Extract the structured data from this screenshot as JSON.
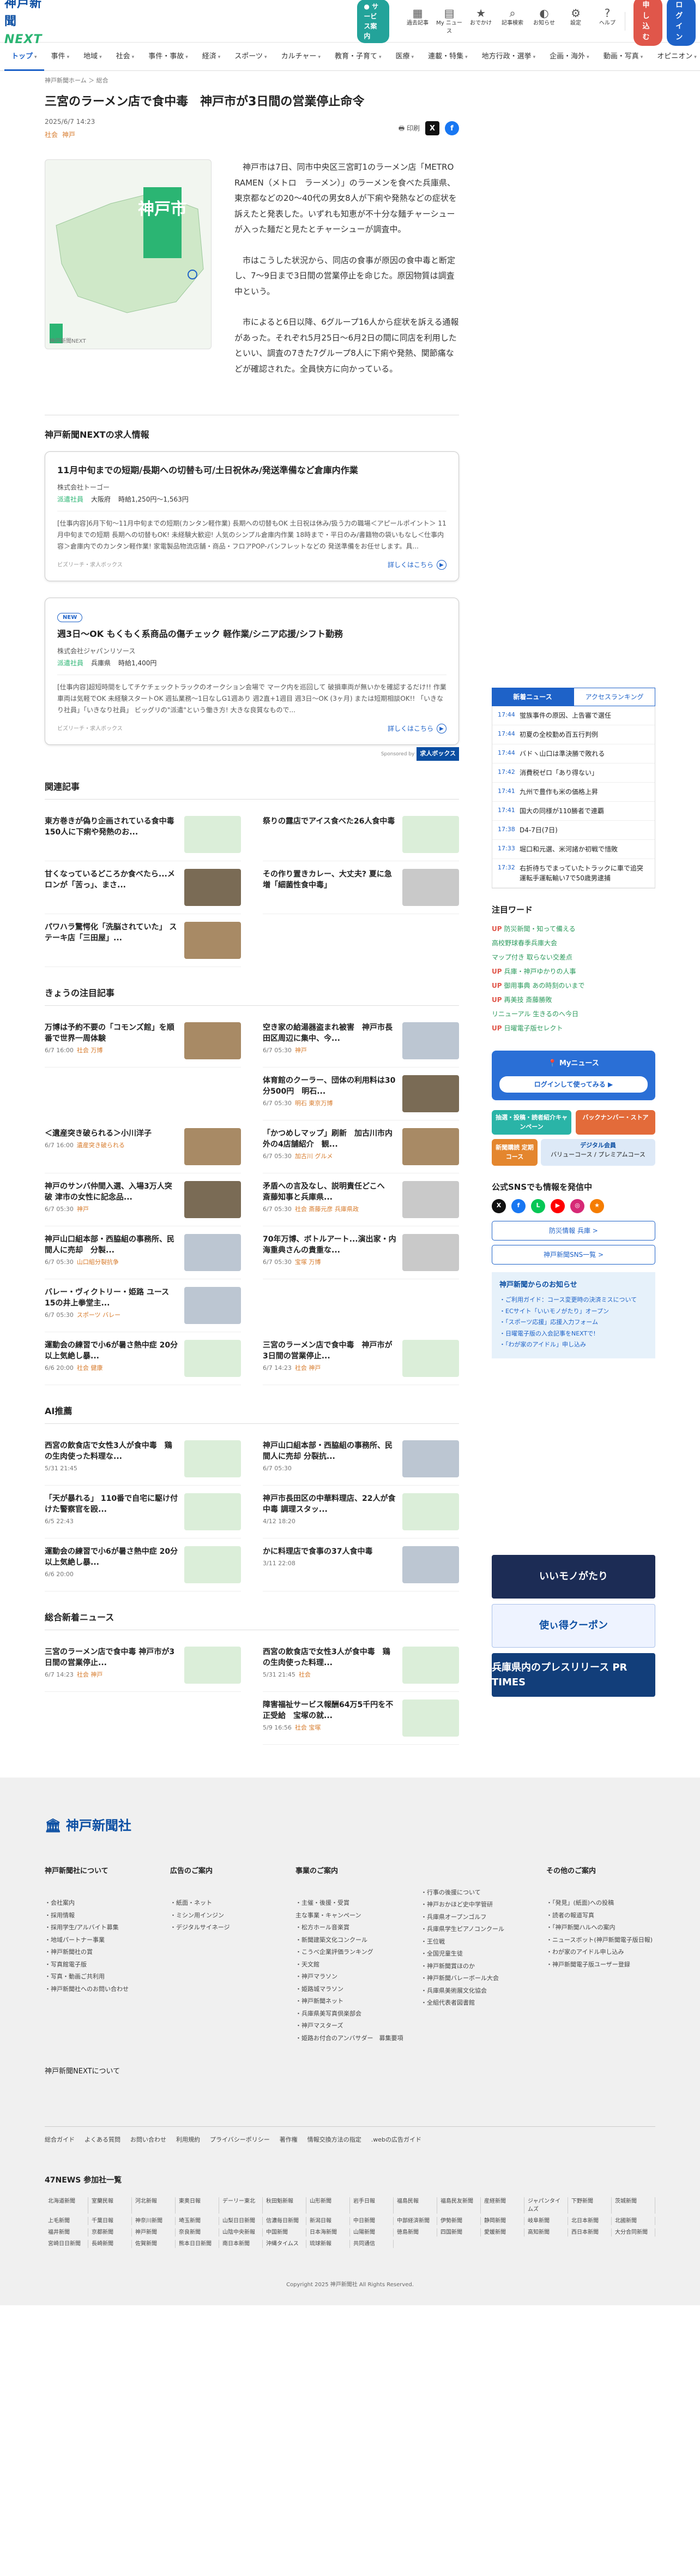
{
  "header": {
    "logo_main": "神戸新聞",
    "logo_sub": "NEXT",
    "guide": "● サービス案内",
    "icons": [
      {
        "icon": "calendar-icon",
        "label": "過去記事"
      },
      {
        "icon": "paper-icon",
        "label": "My ニュース"
      },
      {
        "icon": "bookmark-icon",
        "label": "おでかけ"
      },
      {
        "icon": "mail-icon",
        "label": "記事検索"
      },
      {
        "icon": "bell-icon",
        "label": "お知らせ"
      },
      {
        "icon": "gear-icon",
        "label": "設定"
      },
      {
        "icon": "help-icon",
        "label": "ヘルプ"
      }
    ],
    "signup": "申し込む",
    "login": "ログイン"
  },
  "nav": [
    "トップ",
    "事件",
    "地域",
    "社会",
    "事件・事故",
    "経済",
    "スポーツ",
    "カルチャー",
    "教育・子育て",
    "医療",
    "連載・特集",
    "地方行政・選挙",
    "企画・海外",
    "動画・写真",
    "オピニオン"
  ],
  "crumb": "神戸新聞ホーム ＞ 総合",
  "article": {
    "title": "三宮のラーメン店で食中毒　神戸市が3日間の営業停止命令",
    "date": "2025/6/7 14:23",
    "tags": [
      "社会",
      "神戸"
    ],
    "print": "印刷",
    "thumb_caption": "神戸新聞NEXT",
    "thumb_label": "神戸市",
    "paras": [
      "神戸市は7日、同市中央区三宮町1のラーメン店「METRO RAMEN（メトロ　ラーメン）」のラーメンを食べた兵庫県、東京都などの20～40代の男女8人が下痢や発熱などの症状を訴えたと発表した。いずれも知恵が不十分な麺チャーシューが入った麺だと見たとチャーシューが調査中。",
      "市はこうした状況から、同店の食事が原因の食中毒と断定し、7～9日まで3日間の営業停止を命じた。原因物質は調査中という。",
      "市によると6日以降、6グループ16人から症状を訴える通報があった。それぞれ5月25日～6月2日の間に同店を利用したといい、調査の7きた7グループ8人に下痢や発熱、関節痛などが確認された。全員快方に向かっている。"
    ]
  },
  "jobs": {
    "heading": "神戸新聞NEXTの求人情報",
    "items": [
      {
        "new": "",
        "title": "11月中旬までの短期/長期への切替も可/土日祝休み/発送準備など倉庫内作業",
        "company": "株式会社トーゴー",
        "type": "派遣社員",
        "area": "大阪府",
        "pay": "時給1,250円～1,563円",
        "desc": "[仕事内容]6月下旬～11月中旬までの短期(カンタン軽作業) 長期への切替もOK 土日祝は休み/扱う力の職場＜アピールポイント＞ 11月中旬までの短期 長期への切替もOK! 未経験大歓迎! 人気のシンプル倉庫内作業 18時まで・平日のみ/書籍物の袋いもなし＜仕事内容＞倉庫内でのカンタン軽作業! 家電製品物流店舗・商品・フロアPOP-パンフレットなどの 発送準備をお任せします。具...",
        "src": "ビズリーチ・求人ボックス",
        "more": "詳しくはこちら"
      },
      {
        "new": "NEW",
        "title": "週3日～OK もくもく系商品の傷チェック 軽作業/シニア応援/シフト勤務",
        "company": "株式会社ジャパンリソース",
        "type": "派遣社員",
        "area": "兵庫県",
        "pay": "時給1,400円",
        "desc": "[仕事内容]超短時間をしてチケチェックトラックのオークション会場で マーク内を巡回して 破損車両が無いかを確認するだけ!! 作業車両は気軽でOK 未経験スタートOK 週払業務～1日なしG1週あり 週2直+1週目 週3日～OK (3ヶ月) または短期相談OK!! 「いきなり社員」「いきなり社員」 ビッグリの\"派遣\"という働き方! 大きな良質なもので...",
        "src": "ビズリーチ・求人ボックス",
        "more": "詳しくはこちら"
      }
    ],
    "sponsored": "Sponsored by",
    "sponsor": "求人ボックス"
  },
  "related": {
    "heading": "関連記事",
    "items": [
      {
        "t": "東方巻きが偽り企画されている食中毒 150人に下痢や発熱のお...",
        "img": "grn"
      },
      {
        "t": "祭りの露店でアイス食べた26人食中毒",
        "img": "grn"
      },
      {
        "t": "甘くなっているどころか食べたら...メロンが「苦っ」、まさ...",
        "img": "dk"
      },
      {
        "t": "その作り置きカレー、大丈夫? 夏に急増「細菌性食中毒」",
        "img": "gy"
      },
      {
        "t": "パワハラ驚愕化「洗脳されていた」 ステーキ店「三田屋」...",
        "img": "br"
      },
      {
        "t": "",
        "img": ""
      }
    ]
  },
  "topics": {
    "heading": "きょうの注目記事",
    "items": [
      {
        "t": "万博は予約不要の「コモンズ館」を順番で世界一周体験",
        "d": "6/7 16:00",
        "c": "社会 万博",
        "img": "br"
      },
      {
        "t": "空き家の給湯器盗まれ被害　神戸市長田区周辺に集中、今...",
        "d": "6/7 05:30",
        "c": "神戸",
        "img": "bl"
      },
      {
        "t": "",
        "d": "",
        "c": "",
        "img": ""
      },
      {
        "t": "体育館のクーラー、団体の利用料は30分500円　明石...",
        "d": "6/7 05:30",
        "c": "明石 東京万博",
        "img": "dk"
      },
      {
        "t": "＜遺産突き破られる＞小川洋子",
        "d": "6/7 16:00",
        "c": "遺産突き破られる",
        "img": "br"
      },
      {
        "t": "「かつめしマップ」刷新　加古川市内外の4店舗紹介　観...",
        "d": "6/7 05:30",
        "c": "加古川 グルメ",
        "img": "br"
      },
      {
        "t": "神戸のサンバ仲間入選、入場3万人突破 津市の女性に記念品...",
        "d": "6/7 05:30",
        "c": "神戸",
        "img": "dk"
      },
      {
        "t": "矛盾への言及なし、説明責任どこへ　斎藤知事と兵庫県...",
        "d": "6/7 05:30",
        "c": "社会 斎藤元彦 兵庫県政",
        "img": "gy"
      },
      {
        "t": "神戸山口組本部・西脇組の事務所、民間人に売却　分製...",
        "d": "6/7 05:30",
        "c": "山口組分裂抗争",
        "img": "bl"
      },
      {
        "t": "70年万博、ボトルアート...演出家・内海重典さんの貴重な...",
        "d": "6/7 05:30",
        "c": "宝塚 万博",
        "img": "gy"
      },
      {
        "t": "バレー・ヴィクトリー・姫路 ユース15の井上拳堂主...",
        "d": "6/7 05:30",
        "c": "スポーツ バレー",
        "img": "bl"
      },
      {
        "t": "",
        "d": "",
        "c": "",
        "img": ""
      },
      {
        "t": "運動会の練習で小6が暑さ熱中症 20分以上気絶し暴...",
        "d": "6/6 20:00",
        "c": "社会 健康",
        "img": "grn"
      },
      {
        "t": "三宮のラーメン店で食中毒　神戸市が3日間の営業停止...",
        "d": "6/7 14:23",
        "c": "社会 神戸",
        "img": "grn"
      }
    ]
  },
  "ai": {
    "heading": "AI推薦",
    "items": [
      {
        "t": "西宮の飲食店で女性3人が食中毒　鶏の生肉使った料理な...",
        "d": "5/31 21:45",
        "img": "grn"
      },
      {
        "t": "神戸山口組本部・西脇組の事務所、民間人に売却 分裂抗...",
        "d": "6/7 05:30",
        "img": "bl"
      },
      {
        "t": "「天が暴れる」 110番で自宅に駆け付けた警察官を殴...",
        "d": "6/5 22:43",
        "img": "grn"
      },
      {
        "t": "神戸市長田区の中華料理店、22人が食中毒 調理スタッ...",
        "d": "4/12 18:20",
        "img": "grn"
      },
      {
        "t": "運動会の練習で小6が暑さ熱中症 20分以上気絶し暴...",
        "d": "6/6 20:00",
        "img": "grn"
      },
      {
        "t": "かに料理店で食事の37人食中毒",
        "d": "3/11 22:08",
        "img": "bl"
      }
    ]
  },
  "general": {
    "heading": "総合新着ニュース",
    "items": [
      {
        "t": "三宮のラーメン店で食中毒 神戸市が3日間の営業停止...",
        "d": "6/7 14:23",
        "c": "社会 神戸",
        "img": "grn"
      },
      {
        "t": "西宮の飲食店で女性3人が食中毒　鶏の生肉使った料理...",
        "d": "5/31 21:45",
        "c": "社会",
        "img": "grn"
      },
      {
        "t": "",
        "d": "",
        "c": "",
        "img": ""
      },
      {
        "t": "障害福祉サービス報酬64万5千円を不正受給　宝塚の就...",
        "d": "5/9 16:56",
        "c": "社会 宝塚",
        "img": "grn"
      }
    ]
  },
  "right": {
    "tabs": [
      "新着ニュース",
      "アクセスランキング"
    ],
    "news": [
      {
        "tm": "17:44",
        "t": "蛍族事件の原因、上告審で選任"
      },
      {
        "tm": "17:44",
        "t": "初夏の全校勤め百五行判例"
      },
      {
        "tm": "17:44",
        "t": "バドヽ山口は準決勝で敗れる"
      },
      {
        "tm": "17:42",
        "t": "消費税ゼロ「あり得ない」"
      },
      {
        "tm": "17:41",
        "t": "九州で豊作も米の価格上昇"
      },
      {
        "tm": "17:41",
        "t": "国大の同様が110勝者で連覇"
      },
      {
        "tm": "17:38",
        "t": "D4-7日(7日)"
      },
      {
        "tm": "17:33",
        "t": "堀口和元選、米河諸か初戦で惜敗"
      },
      {
        "tm": "17:32",
        "t": "右折待ちでまっていたトラックに車で追突　運転手運転輸い7で50歳男逮捕"
      }
    ],
    "kw_heading": "注目ワード",
    "keywords": [
      {
        "up": "UP",
        "t": "防災新聞・知って備える"
      },
      {
        "up": "",
        "t": "高校野球春季兵庫大会"
      },
      {
        "up": "",
        "t": "マップ付き 取らない交差点"
      },
      {
        "up": "UP",
        "t": "兵庫・神戸ゆかりの人事"
      },
      {
        "up": "UP",
        "t": "御用事典 あの時刻のいまで"
      },
      {
        "up": "UP",
        "t": "再美技 斎藤勝敗"
      },
      {
        "up": "",
        "t": "リニューアル 生きるのへ今日"
      },
      {
        "up": "UP",
        "t": "日曜電子版セレクト"
      }
    ],
    "my": "Myニュース",
    "my_btn": "ログインして使ってみる ▶",
    "promos": [
      "抽選・投稿・読者紹介キャンペーン",
      "バックナンバー・ストア"
    ],
    "digital_title": "デジタル会員",
    "digital": [
      "新聞購読 定期コース",
      "バリューコース",
      "プレミアムコース"
    ],
    "sns_heading": "公式SNSでも情報を発信中",
    "btn1": "防災情報  兵庫  >",
    "btn2": "神戸新聞SNS一覧  >",
    "ann_heading": "神戸新聞からのお知らせ",
    "anns": [
      "・ご利用ガイド：コース変更時の決済ミスについて",
      "・ECサイト「いいモノがたり」オープン",
      "・「スポーツ応援」応援入力フォーム",
      "・日曜電子版の入会記事をNEXTで!",
      "・「わが家のアイドル」申し込み"
    ],
    "banners": [
      "いいモノがたり",
      "使ぃ得クーポン",
      "兵庫県内のプレスリリース PR TIMES"
    ]
  },
  "footer": {
    "logo": "神戸新聞社",
    "cols": [
      {
        "h": "神戸新聞社について",
        "items": [
          "・会社案内",
          "・採用情報",
          "・採用学生/アルバイト募集",
          "・地域パートナー事業",
          "・神戸新聞社の賞",
          "・写真館電子版",
          "・写真・動画ご共利用",
          "・神戸新聞社へのお問い合わせ"
        ]
      },
      {
        "h": "広告のご案内",
        "items": [
          "・紙面・ネット",
          "・ミシン用インジン",
          "・デジタルサイネージ"
        ]
      },
      {
        "h": "事業のご案内",
        "items": [
          "・主催・後援・受賞",
          "主な事業・キャンペーン",
          "・松方ホール音楽賞",
          "・新聞建築文化コンクール",
          "・こうべ企業評価ランキング",
          "・天文館",
          "・神戸マラソン",
          "・姫路城マラソン",
          "・神戸新聞ネット",
          "・兵庫県美写真倶楽部会",
          "・神戸マスターズ",
          "・姫路お付合のアンバサダー　募集要項"
        ]
      },
      {
        "h": "",
        "items": [
          "・行事の後援について",
          "・神戸おかほど史中学管研",
          "・兵庫県オープンゴルフ",
          "・兵庫県学生ピアノコンクール",
          "・王位戦",
          "・全国児童生徒",
          "・神戸新聞賞ほのか",
          "・神戸新聞バレーボール大会",
          "・兵庫県美術展文化協会",
          "・全組代表者図書館"
        ]
      },
      {
        "h": "その他のご案内",
        "items": [
          "・「発見」(紙面)への投稿",
          "・読者の報道写真",
          "・「神戸新聞ハルへの案内",
          "・ニュースボット(神戸新聞電子版日報)",
          "・わが家のアイドル申し込み",
          "・神戸新聞電子版ユーザー登録"
        ]
      }
    ],
    "next": "神戸新聞NEXTについて",
    "bar": [
      "総合ガイド",
      "よくある質問",
      "お問い合わせ",
      "利用規約",
      "プライバシーポリシー",
      "著作権",
      "情報交換方法の指定",
      ".webの広告ガイド"
    ],
    "n47": "47NEWS 参加社一覧",
    "papers": [
      "北海道新聞",
      "室蘭民報",
      "河北新報",
      "東奥日報",
      "デーリー東北",
      "秋田魁新報",
      "山形新聞",
      "岩手日報",
      "福島民報",
      "福島民友新聞",
      "産経新聞",
      "ジャパンタイムズ",
      "下野新聞",
      "茨城新聞",
      "上毛新聞",
      "千葉日報",
      "神奈川新聞",
      "埼玉新聞",
      "山梨日日新聞",
      "信濃毎日新聞",
      "新潟日報",
      "中日新聞",
      "中部経済新聞",
      "伊勢新聞",
      "静岡新聞",
      "岐阜新聞",
      "北日本新聞",
      "北國新聞",
      "福井新聞",
      "京都新聞",
      "神戸新聞",
      "奈良新聞",
      "山陰中央新報",
      "中国新聞",
      "日本海新聞",
      "山陽新聞",
      "徳島新聞",
      "四国新聞",
      "愛媛新聞",
      "高知新聞",
      "西日本新聞",
      "大分合同新聞",
      "宮崎日日新聞",
      "長崎新聞",
      "佐賀新聞",
      "熊本日日新聞",
      "南日本新聞",
      "沖縄タイムス",
      "琉球新報",
      "共同通信"
    ],
    "copy": "Copyright 2025 神戸新聞社 All Rights Reserved."
  }
}
